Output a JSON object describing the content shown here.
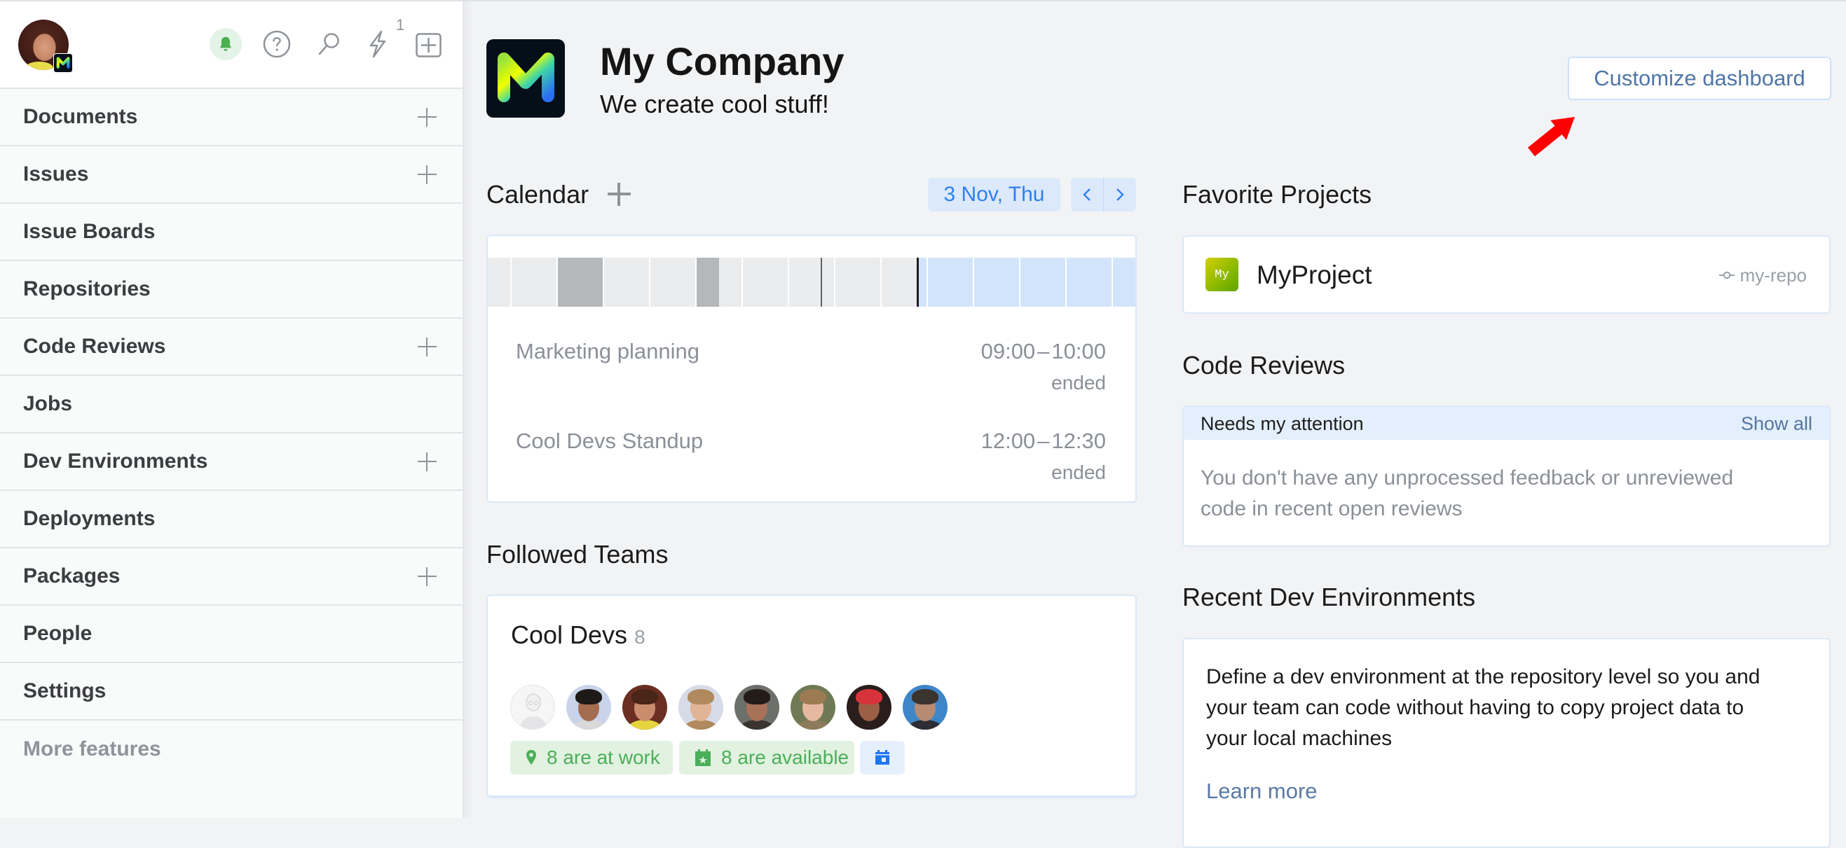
{
  "sidebar": {
    "user": {
      "org_badge_letter": "M"
    },
    "toolbar": {
      "lightning_badge": "1"
    },
    "items": [
      {
        "label": "Documents",
        "has_add": true
      },
      {
        "label": "Issues",
        "has_add": true
      },
      {
        "label": "Issue Boards",
        "has_add": false
      },
      {
        "label": "Repositories",
        "has_add": false
      },
      {
        "label": "Code Reviews",
        "has_add": true
      },
      {
        "label": "Jobs",
        "has_add": false
      },
      {
        "label": "Dev Environments",
        "has_add": true
      },
      {
        "label": "Deployments",
        "has_add": false
      },
      {
        "label": "Packages",
        "has_add": true
      },
      {
        "label": "People",
        "has_add": false
      },
      {
        "label": "Settings",
        "has_add": false
      }
    ],
    "more_features": "More features"
  },
  "header": {
    "company_name": "My Company",
    "tagline": "We create cool stuff!",
    "customize_button": "Customize dashboard"
  },
  "calendar": {
    "title": "Calendar",
    "date_label": "3 Nov, Thu",
    "timeline": {
      "visible_from": "07:30",
      "visible_to": "21:30",
      "marker_time": "14:43",
      "now_time": "16:48"
    },
    "time_separator": "–",
    "events": [
      {
        "title": "Marketing planning",
        "start": "09:00",
        "end": "10:00",
        "status": "ended"
      },
      {
        "title": "Cool Devs Standup",
        "start": "12:00",
        "end": "12:30",
        "status": "ended"
      }
    ]
  },
  "followed_teams": {
    "title": "Followed Teams",
    "team": {
      "name": "Cool Devs",
      "member_count": "8",
      "at_work": "8 are at work",
      "available": "8 are available",
      "members": [
        {
          "type": "placeholder"
        },
        {
          "type": "photo",
          "bg": "#c9d4ea",
          "hair": "#1e1a18",
          "skin": "#a46d4f",
          "body": "#d9d9dc"
        },
        {
          "type": "photo",
          "bg": "#6b2e22",
          "hair": "#4a2618",
          "skin": "#c98d6e",
          "body": "#e5d43e"
        },
        {
          "type": "photo",
          "bg": "#d7dbe8",
          "hair": "#b08a5e",
          "skin": "#e1b497",
          "body": "#b08a5e"
        },
        {
          "type": "photo",
          "bg": "#6d6f6a",
          "hair": "#231c19",
          "skin": "#a87258",
          "body": "#3a3431"
        },
        {
          "type": "photo",
          "bg": "#6f7a55",
          "hair": "#9c7a52",
          "skin": "#e6b8a0",
          "body": "#8c7a5a"
        },
        {
          "type": "photo",
          "bg": "#2a1e1c",
          "hair": "#d6343a",
          "skin": "#9b5f45",
          "body": "#2a1e1c"
        },
        {
          "type": "photo",
          "bg": "#3f86c8",
          "hair": "#3b332e",
          "skin": "#b88a72",
          "body": "#2d2d33"
        }
      ]
    }
  },
  "favorite_projects": {
    "title": "Favorite Projects",
    "projects": [
      {
        "icon_text": "My",
        "name": "MyProject",
        "repo": "my-repo"
      }
    ]
  },
  "code_reviews": {
    "title": "Code Reviews",
    "filter_label": "Needs my attention",
    "show_all": "Show all",
    "empty_message": "You don't have any unprocessed feedback or unreviewed code in recent open reviews"
  },
  "dev_environments": {
    "title": "Recent Dev Environments",
    "description": "Define a dev environment at the repository level so you and your team can code without having to copy project data to your local machines",
    "learn_more": "Learn more"
  },
  "colors": {
    "accent_blue": "#2f7ff0",
    "link": "#5b7ba6",
    "success_green": "#4cae5a",
    "annotation_arrow": "#ff0000"
  }
}
